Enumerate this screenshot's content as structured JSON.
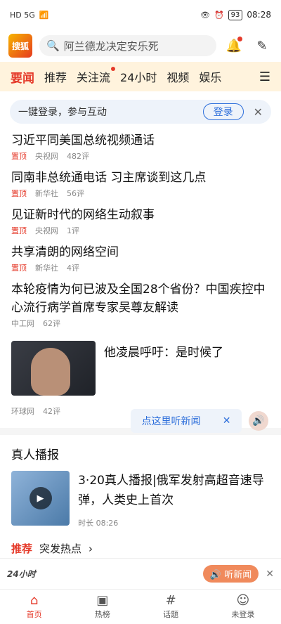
{
  "status": {
    "left": "HD 5G",
    "battery": "93",
    "time": "08:28"
  },
  "header": {
    "logo": "搜狐",
    "search_placeholder": "阿兰德龙决定安乐死"
  },
  "tabs": [
    {
      "label": "要闻"
    },
    {
      "label": "推荐"
    },
    {
      "label": "关注流"
    },
    {
      "label": "24小时"
    },
    {
      "label": "视频"
    },
    {
      "label": "娱乐"
    }
  ],
  "login_banner": {
    "text": "一键登录，参与互动",
    "button": "登录"
  },
  "news": [
    {
      "title": "习近平同美国总统视频通话",
      "pin": "置顶",
      "source": "央视网",
      "comments": "482评"
    },
    {
      "title": "同南非总统通电话 习主席谈到这几点",
      "pin": "置顶",
      "source": "新华社",
      "comments": "56评"
    },
    {
      "title": "见证新时代的网络生动叙事",
      "pin": "置顶",
      "source": "央视网",
      "comments": "1评"
    },
    {
      "title": "共享清朗的网络空间",
      "pin": "置顶",
      "source": "新华社",
      "comments": "4评"
    },
    {
      "title": "本轮疫情为何已波及全国28个省份？中国疾控中心流行病学首席专家吴尊友解读",
      "pin": "",
      "source": "中工网",
      "comments": "62评"
    }
  ],
  "image_item": {
    "title": "他凌晨呼吁：是时候了",
    "source": "环球网",
    "comments": "42评"
  },
  "listen_prompt": {
    "text": "点这里听新闻"
  },
  "section": {
    "title": "真人播报"
  },
  "broadcast": {
    "title": "3·20真人播报|俄军发射高超音速导弹，人类史上首次",
    "duration": "时长 08:26"
  },
  "hot": {
    "label": "推荐",
    "text": "突发热点"
  },
  "mini_player": {
    "label": "24小时",
    "button": "听新闻"
  },
  "bottom_nav": [
    {
      "label": "首页"
    },
    {
      "label": "热榜"
    },
    {
      "label": "话题"
    },
    {
      "label": "未登录"
    }
  ],
  "colors": {
    "accent": "#e53a2a",
    "link": "#2c6edb",
    "tab_bg": "#fff3dd"
  }
}
